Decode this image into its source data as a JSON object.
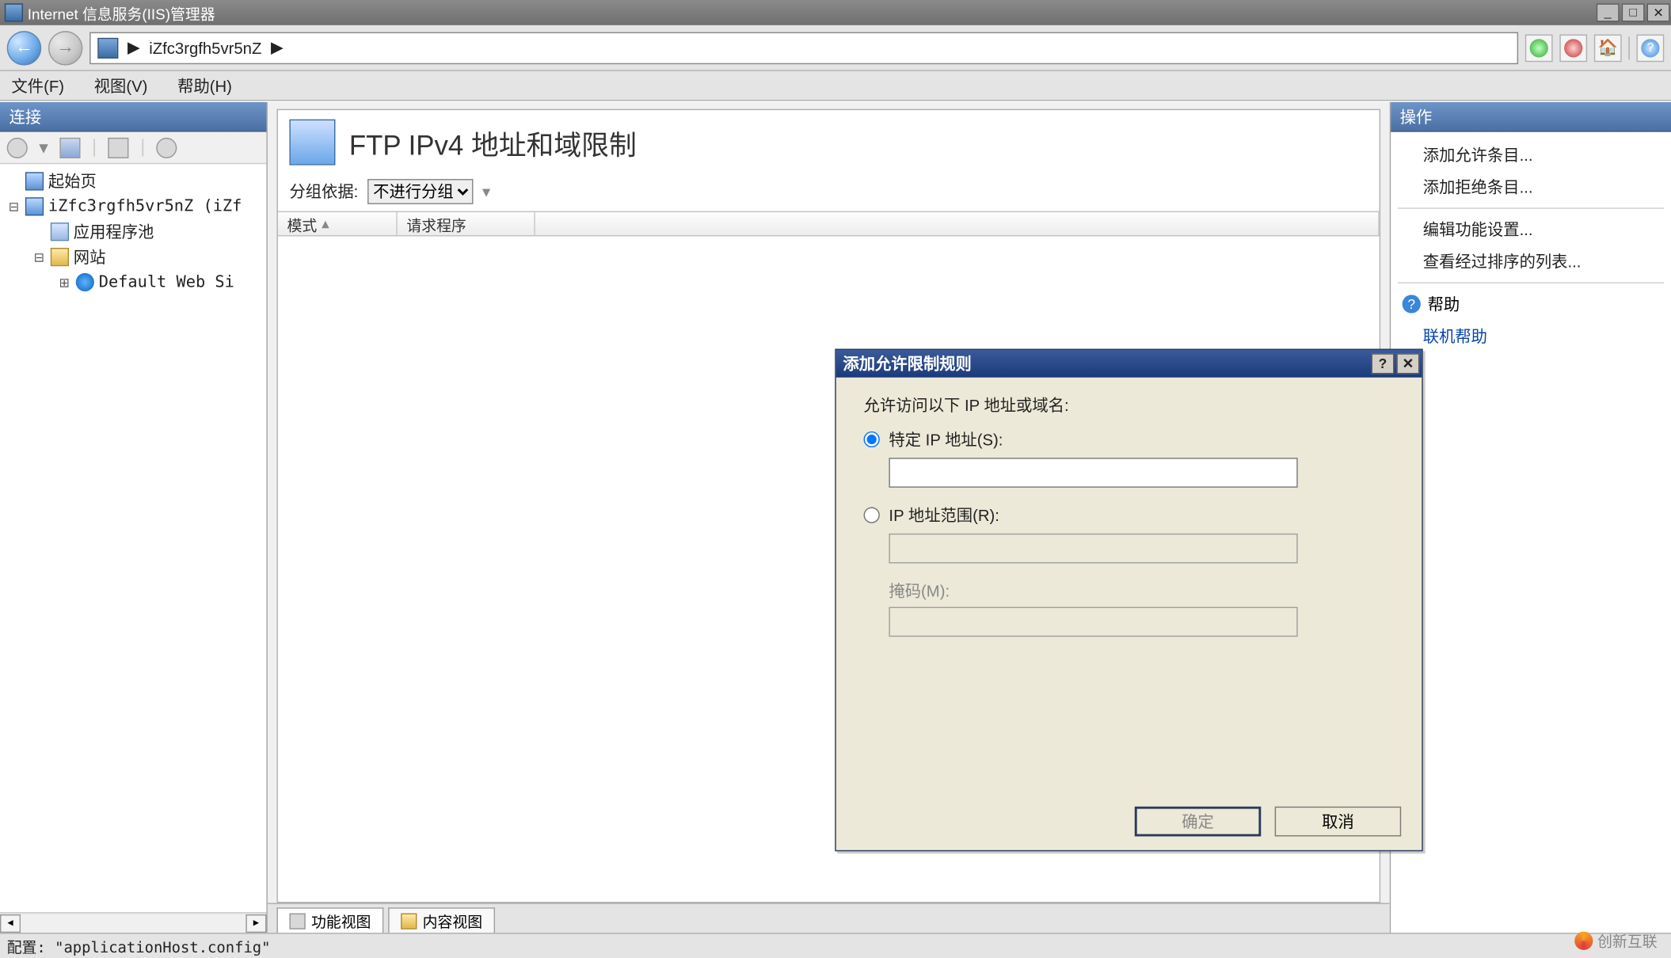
{
  "window": {
    "title": "Internet 信息服务(IIS)管理器"
  },
  "address": {
    "path": "iZfc3rgfh5vr5nZ",
    "arrow": "▶"
  },
  "menu": {
    "file": "文件(F)",
    "view": "视图(V)",
    "help": "帮助(H)"
  },
  "left": {
    "header": "连接",
    "tree": {
      "start": "起始页",
      "server": "iZfc3rgfh5vr5nZ (iZf",
      "apppool": "应用程序池",
      "sites": "网站",
      "default_site": "Default Web Si"
    }
  },
  "center": {
    "title": "FTP IPv4 地址和域限制",
    "group_label": "分组依据:",
    "group_value": "不进行分组",
    "col_mode": "模式",
    "col_requestor": "请求程序",
    "tabs": {
      "feature": "功能视图",
      "content": "内容视图"
    }
  },
  "right": {
    "header": "操作",
    "add_allow": "添加允许条目...",
    "add_deny": "添加拒绝条目...",
    "edit_feature": "编辑功能设置...",
    "view_ordered": "查看经过排序的列表...",
    "help": "帮助",
    "online_help": "联机帮助"
  },
  "dialog": {
    "title": "添加允许限制规则",
    "prompt": "允许访问以下 IP 地址或域名:",
    "opt_specific": "特定 IP 地址(S):",
    "opt_range": "IP 地址范围(R):",
    "mask_label": "掩码(M):",
    "ok": "确定",
    "cancel": "取消"
  },
  "status": {
    "text": "配置: \"applicationHost.config\""
  },
  "watermark": "创新互联"
}
